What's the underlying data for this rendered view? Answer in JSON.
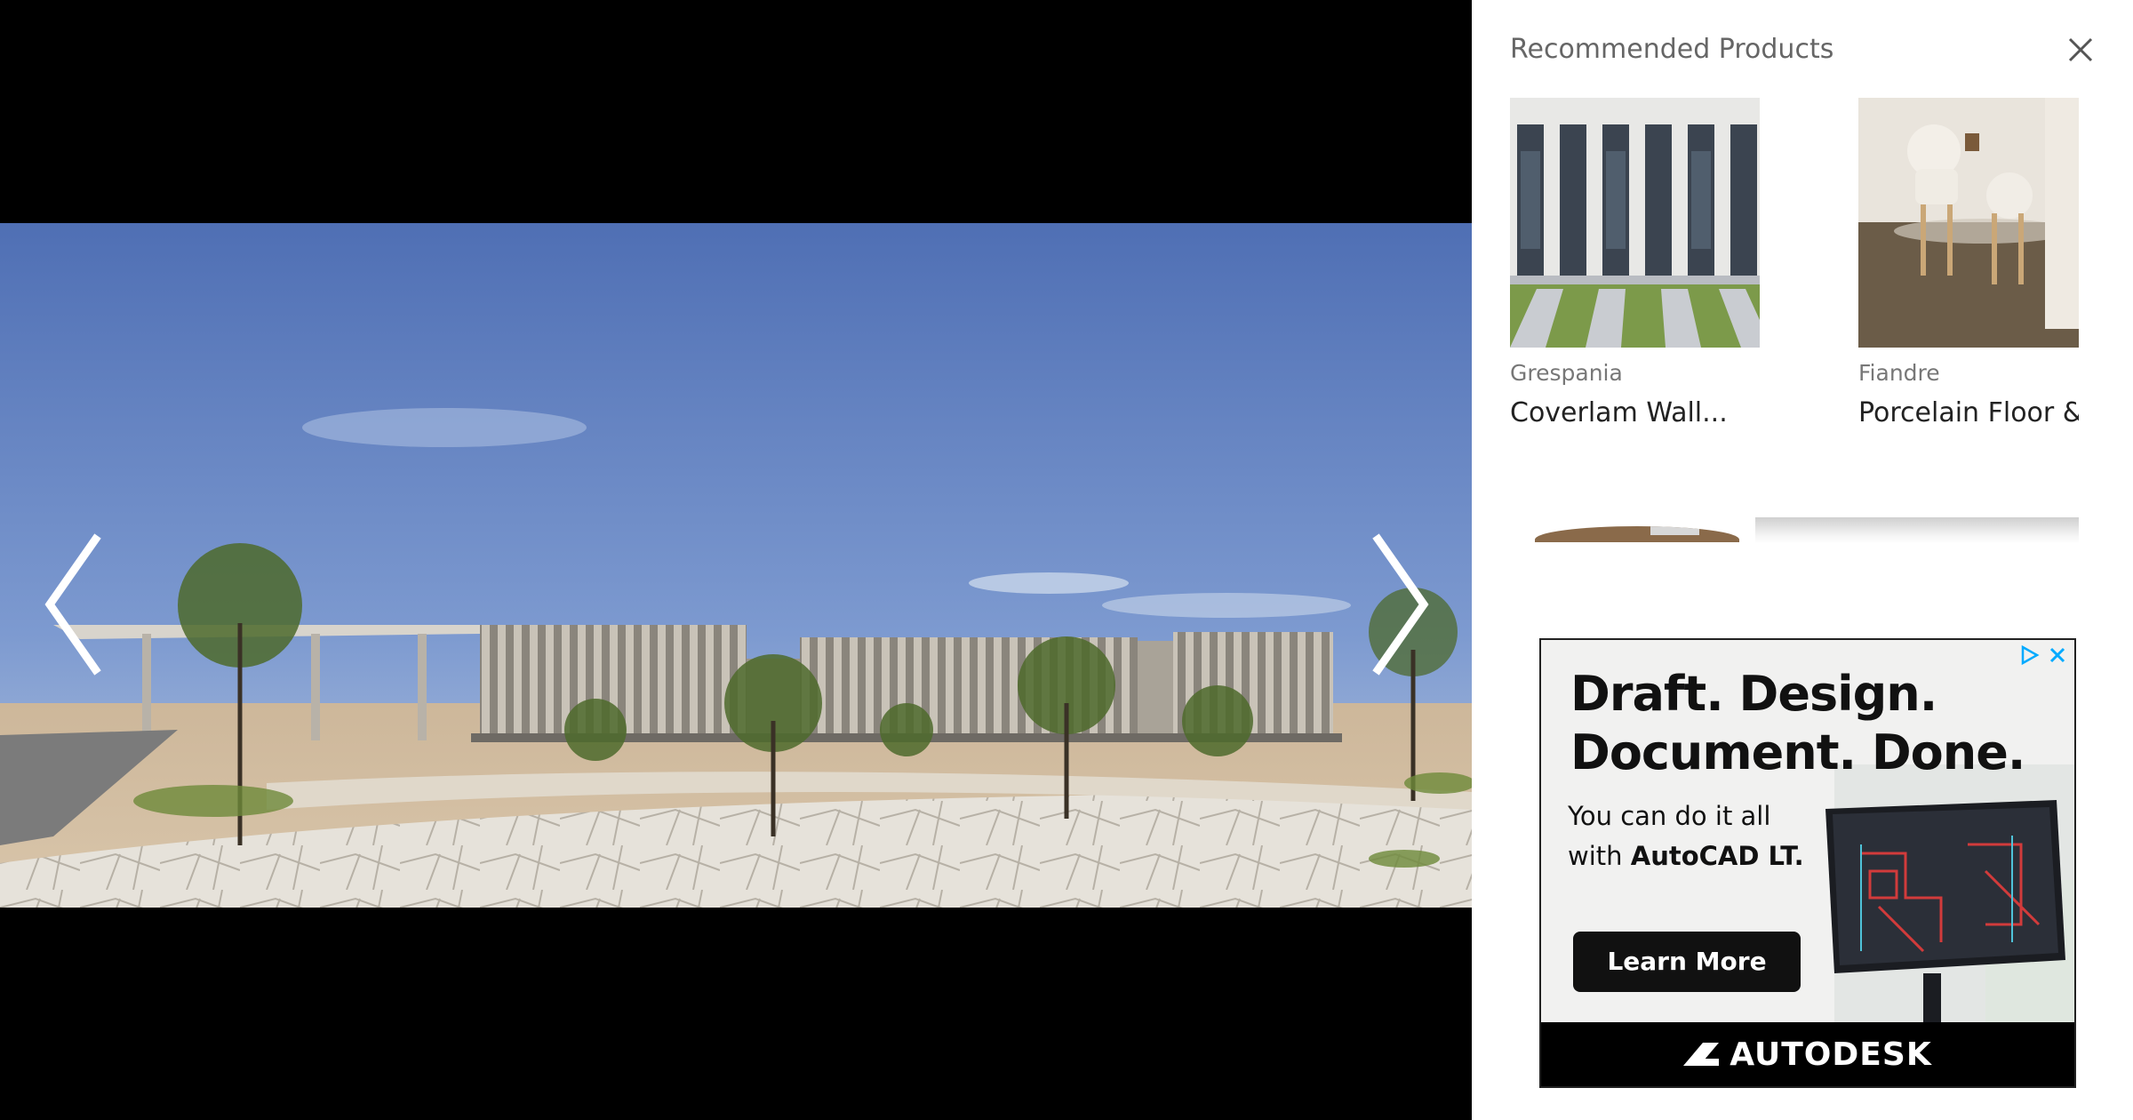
{
  "gallery": {
    "prev_icon": "chevron-left-icon",
    "next_icon": "chevron-right-icon"
  },
  "panel": {
    "title": "Recommended Products",
    "close_icon": "close-icon",
    "products": [
      {
        "brand": "Grespania",
        "name": "Coverlam Wall..."
      },
      {
        "brand": "Fiandre",
        "name": "Porcelain Floor &..."
      }
    ]
  },
  "ad": {
    "headline_line1": "Draft. Design.",
    "headline_line2": "Document. Done.",
    "sub_line1": "You can do it all",
    "sub_line2_prefix": "with ",
    "sub_line2_bold": "AutoCAD LT.",
    "cta": "Learn More",
    "brand": "AUTODESK",
    "adchoices_icon": "adchoices-icon",
    "ad_close_icon": "ad-close-icon"
  },
  "colors": {
    "panel_bg": "#ffffff",
    "gallery_bg": "#000000",
    "title_text": "#666666",
    "brand_text": "#777777",
    "product_text": "#222222",
    "adchoices_blue": "#00aaff"
  }
}
